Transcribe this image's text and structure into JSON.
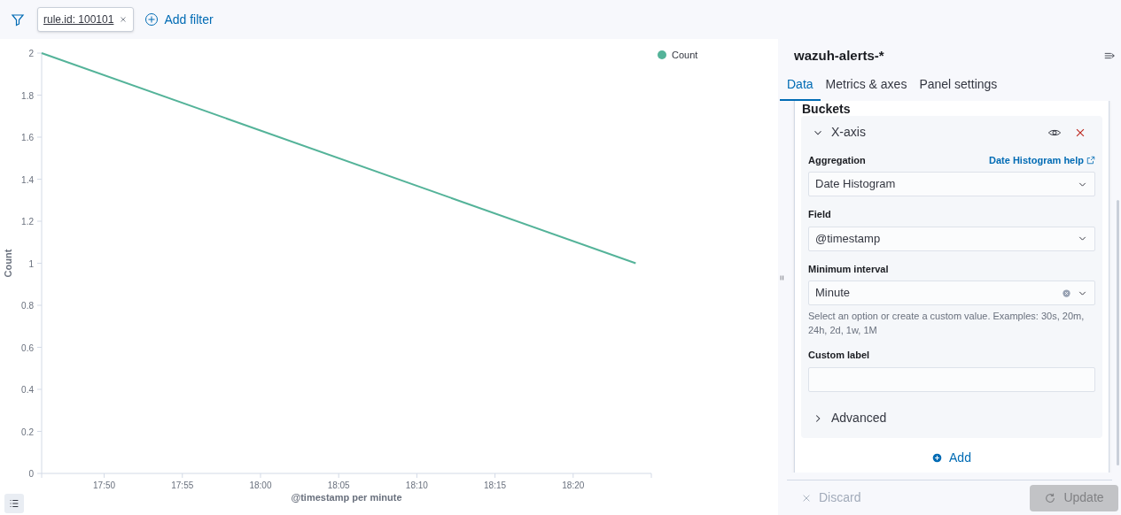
{
  "filter_bar": {
    "filters": [
      {
        "label": "rule.id: 100101"
      }
    ],
    "add_filter": "Add filter"
  },
  "chart": {
    "chart_data": {
      "type": "line",
      "xlabel": "@timestamp per minute",
      "ylabel": "Count",
      "x": [
        1066,
        1104
      ],
      "series": [
        {
          "name": "Count",
          "color": "#54b399",
          "values": [
            2,
            1
          ]
        }
      ],
      "xlim": [
        1066,
        1105
      ],
      "ylim": [
        0,
        2
      ],
      "xticks": [
        {
          "value": 1070,
          "label": "17:50"
        },
        {
          "value": 1075,
          "label": "17:55"
        },
        {
          "value": 1080,
          "label": "18:00"
        },
        {
          "value": 1085,
          "label": "18:05"
        },
        {
          "value": 1090,
          "label": "18:10"
        },
        {
          "value": 1095,
          "label": "18:15"
        },
        {
          "value": 1100,
          "label": "18:20"
        }
      ],
      "yticks": [
        0,
        {
          "value": 0.2,
          "label": "0.2"
        },
        {
          "value": 0.4,
          "label": "0.4"
        },
        {
          "value": 0.6,
          "label": "0.6"
        },
        {
          "value": 0.8,
          "label": "0.8"
        },
        1,
        {
          "value": 1.2,
          "label": "1.2"
        },
        {
          "value": 1.4,
          "label": "1.4"
        },
        {
          "value": 1.6,
          "label": "1.6"
        },
        {
          "value": 1.8,
          "label": "1.8"
        },
        2
      ]
    }
  },
  "editor": {
    "title": "wazuh-alerts-*",
    "tabs": [
      {
        "label": "Data",
        "selected": true
      },
      {
        "label": "Metrics & axes",
        "selected": false
      },
      {
        "label": "Panel settings",
        "selected": false
      }
    ],
    "section_title": "Buckets",
    "bucket": {
      "title": "X-axis",
      "expanded": true,
      "fields": [
        {
          "label": "Aggregation",
          "help_link": "Date Histogram help",
          "value": "Date Histogram"
        },
        {
          "label": "Field",
          "value": "@timestamp"
        },
        {
          "label": "Minimum interval",
          "value": "Minute",
          "clearable": true,
          "hint": "Select an option or create a custom value. Examples: 30s, 20m, 24h, 2d, 1w, 1M"
        },
        {
          "label": "Custom label"
        }
      ],
      "advanced": {
        "label": "Advanced",
        "expanded": false
      }
    },
    "add_button": "Add",
    "discard": "Discard",
    "update": {
      "label": "Update",
      "disabled": true
    }
  }
}
